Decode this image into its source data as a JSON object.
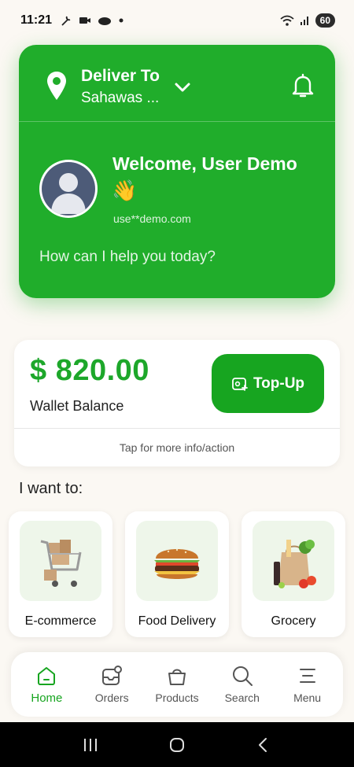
{
  "status_bar": {
    "time": "11:21",
    "battery": "60"
  },
  "header": {
    "deliver_title": "Deliver To",
    "address": "Sahawas ...",
    "welcome": "Welcome, User Demo",
    "wave": "👋",
    "email": "use**demo.com",
    "help_prompt": "How can I help you today?"
  },
  "wallet": {
    "amount": "$ 820.00",
    "label": "Wallet Balance",
    "topup_label": "Top-Up",
    "hint": "Tap for more info/action"
  },
  "section": {
    "heading": "I want to:"
  },
  "services": [
    {
      "label": "E-commerce",
      "icon": "shopping-cart-icon"
    },
    {
      "label": "Food Delivery",
      "icon": "burger-icon"
    },
    {
      "label": "Grocery",
      "icon": "grocery-bag-icon"
    }
  ],
  "nav": [
    {
      "label": "Home",
      "icon": "home-icon",
      "active": true
    },
    {
      "label": "Orders",
      "icon": "orders-icon"
    },
    {
      "label": "Products",
      "icon": "basket-icon"
    },
    {
      "label": "Search",
      "icon": "search-icon"
    },
    {
      "label": "Menu",
      "icon": "menu-icon"
    }
  ],
  "colors": {
    "brand_green": "#20ad2b",
    "button_green": "#17a520",
    "background": "#fbf8f3"
  }
}
